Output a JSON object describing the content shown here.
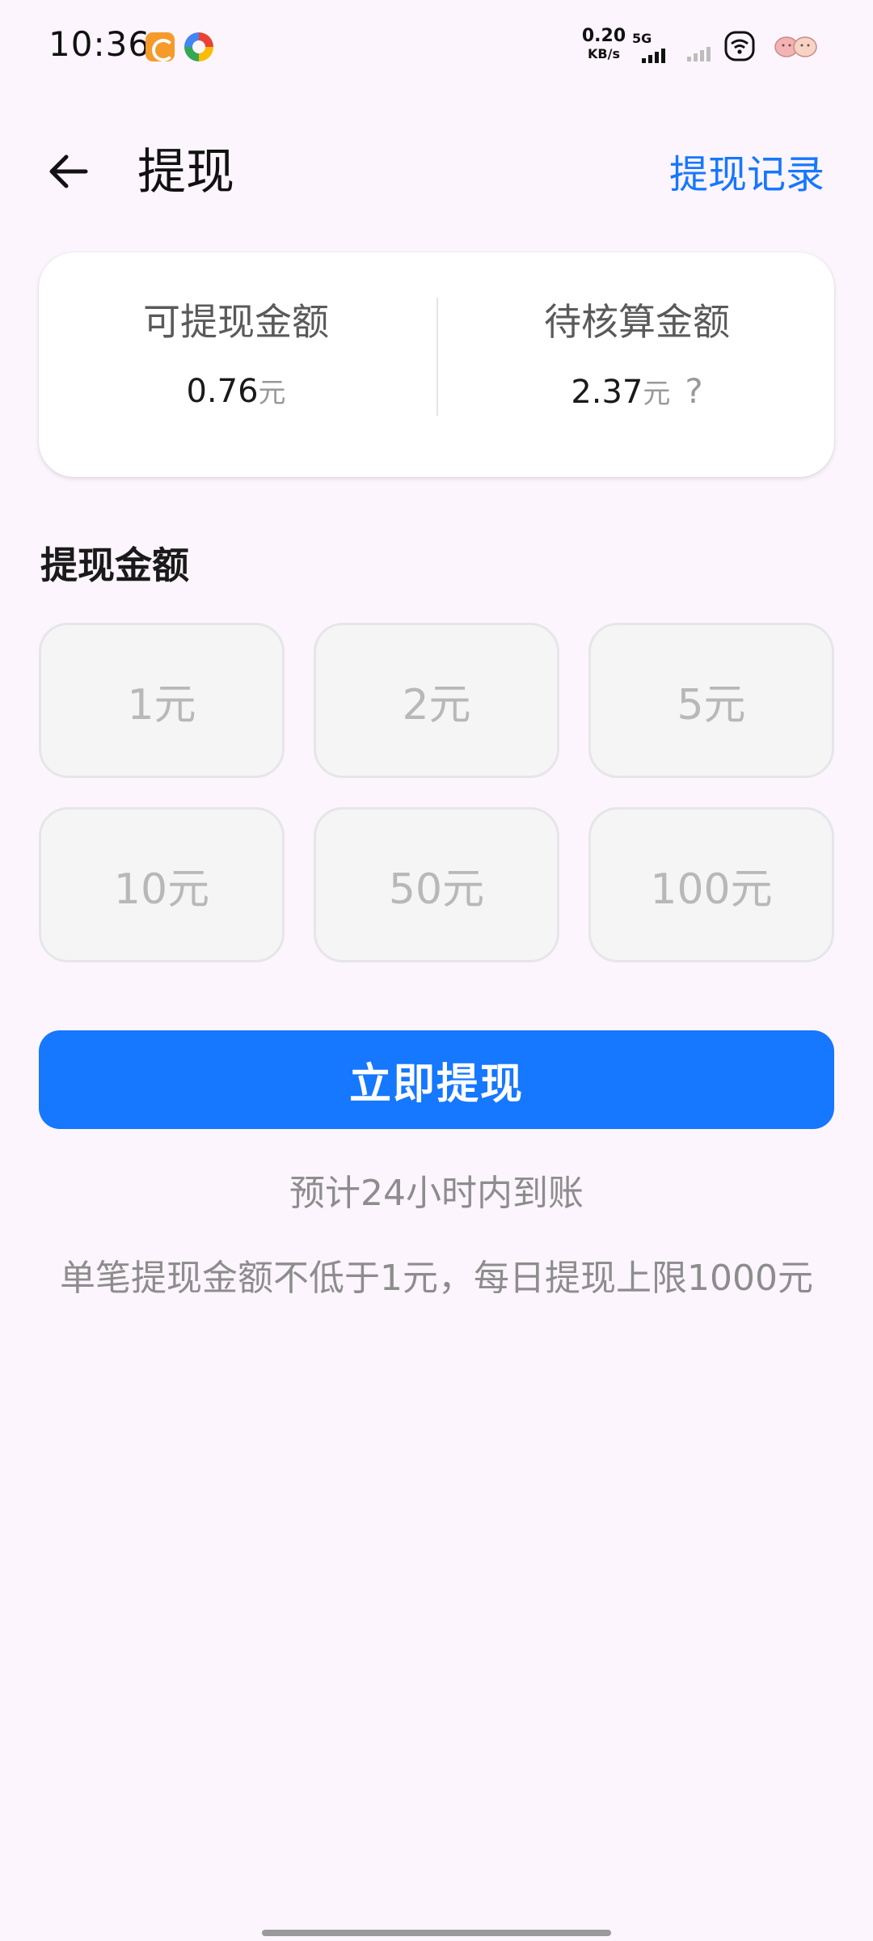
{
  "status_bar": {
    "time": "10:36",
    "network_speed_value": "0.20",
    "network_speed_unit": "KB/s",
    "network_type": "5G"
  },
  "header": {
    "title": "提现",
    "record_link": "提现记录"
  },
  "balance": {
    "available_label": "可提现金额",
    "available_value": "0.76",
    "available_unit": "元",
    "pending_label": "待核算金额",
    "pending_value": "2.37",
    "pending_unit": "元",
    "pending_help": "?"
  },
  "amount_section": {
    "title": "提现金额",
    "options": [
      "1元",
      "2元",
      "5元",
      "10元",
      "50元",
      "100元"
    ]
  },
  "withdraw_button": "立即提现",
  "notes": {
    "eta": "预计24小时内到账",
    "limit": "单笔提现金额不低于1元，每日提现上限1000元"
  },
  "colors": {
    "accent": "#1677ff",
    "background": "#fcf5fd"
  }
}
